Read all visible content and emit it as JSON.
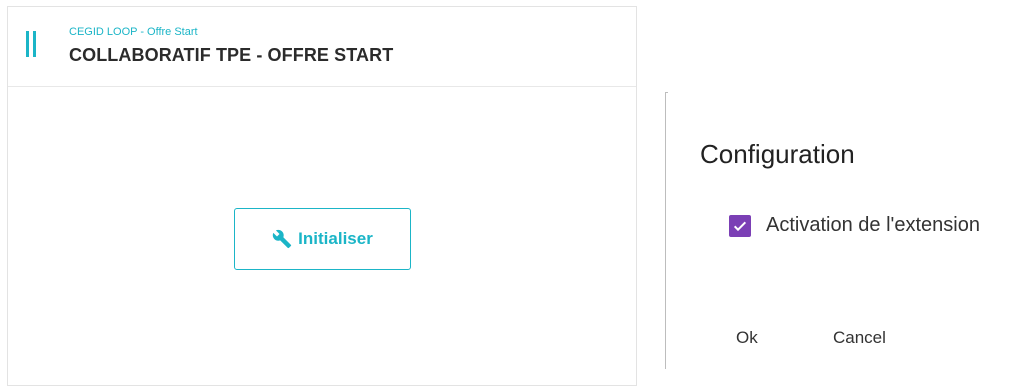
{
  "app_card": {
    "subtitle": "CEGID LOOP - Offre Start",
    "title": "COLLABORATIF TPE - OFFRE START",
    "header_icon": "vertical-bars-icon",
    "init_button": {
      "label": "Initialiser",
      "icon": "wrench-icon"
    }
  },
  "dialog": {
    "title": "Configuration",
    "checkbox": {
      "label": "Activation de l'extension",
      "checked": true
    },
    "ok_label": "Ok",
    "cancel_label": "Cancel"
  },
  "colors": {
    "accent": "#1bb5c7",
    "checkbox": "#7b3fb5",
    "title_text": "#2b2b2b"
  }
}
